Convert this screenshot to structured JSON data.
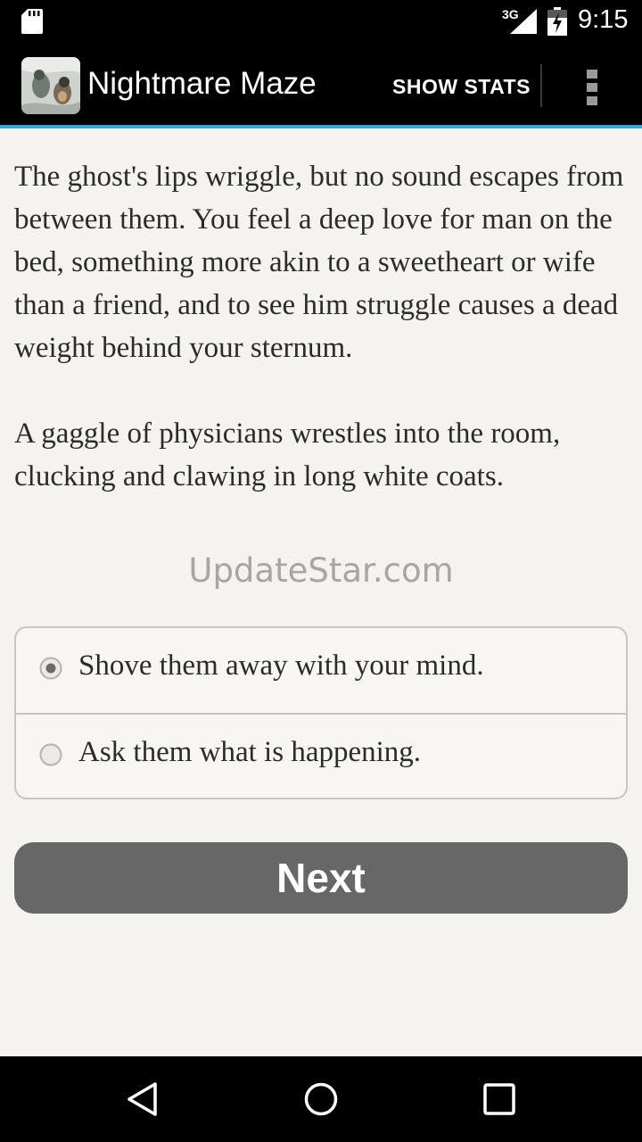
{
  "status_bar": {
    "network": "3G",
    "time": "9:15"
  },
  "action_bar": {
    "title": "Nightmare Maze",
    "show_stats_label": "SHOW STATS"
  },
  "story": {
    "paragraphs": [
      "The ghost's lips wriggle, but no sound escapes from between them. You feel a deep love for man on the bed, something more akin to a sweetheart or wife than a friend, and to see him struggle causes a dead weight behind your sternum.",
      "A gaggle of physicians wrestles into the room, clucking and clawing in long white coats."
    ]
  },
  "watermark": "UpdateStar.com",
  "choices": [
    {
      "label": "Shove them away with your mind.",
      "selected": true
    },
    {
      "label": "Ask them what is happening.",
      "selected": false
    }
  ],
  "next_label": "Next",
  "colors": {
    "accent": "#33a8d8",
    "background": "#f5f3ef",
    "button": "#676767"
  }
}
